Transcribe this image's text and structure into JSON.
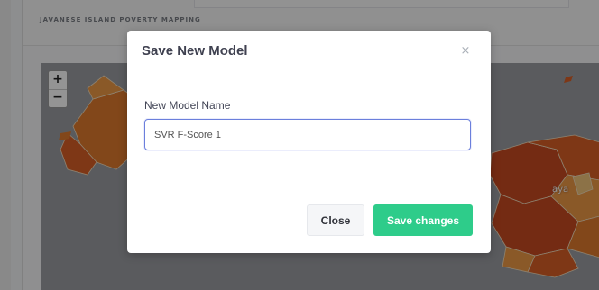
{
  "card": {
    "title": "JAVANESE ISLAND POVERTY MAPPING"
  },
  "map": {
    "zoom_in_label": "+",
    "zoom_out_label": "−",
    "visible_label": "aya",
    "colors": {
      "dark": "#c94a22",
      "mid": "#e07a2e",
      "light": "#ee9a45",
      "pale": "#f2c47a",
      "background": "#9b9ea2"
    }
  },
  "modal": {
    "title": "Save New Model",
    "close_icon": "×",
    "field_label": "New Model Name",
    "input_value": "SVR F-Score 1",
    "close_button": "Close",
    "save_button": "Save changes"
  },
  "colors": {
    "accent": "#2ecc8a",
    "input_border": "#6b7fdc"
  }
}
